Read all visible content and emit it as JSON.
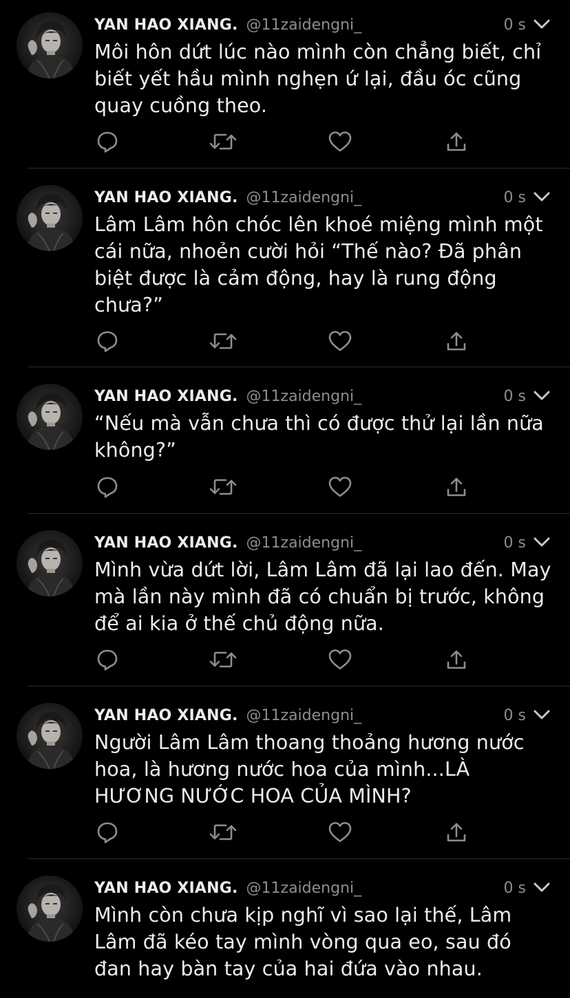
{
  "author": {
    "name": "YAN HAO XIANG.",
    "handle": "@11zaidengni_"
  },
  "colors": {
    "background": "#000000",
    "text": "#ececec",
    "secondary": "#8b8d91",
    "icon": "#8b8d91",
    "divider": "#2b2d30"
  },
  "icons": {
    "reply": "reply-icon",
    "retweet": "retweet-icon",
    "like": "heart-icon",
    "share": "share-icon",
    "more": "chevron-down-icon"
  },
  "tweets": [
    {
      "time": "0 s",
      "lines": [
        "Môi hôn dứt lúc nào mình còn chẳng biết, chỉ",
        "biết yết hầu mình nghẹn ứ lại, đầu óc cũng",
        "quay cuồng theo."
      ]
    },
    {
      "time": "0 s",
      "lines": [
        "Lâm Lâm hôn chóc lên khoé miệng mình một",
        "cái nữa, nhoẻn cười hỏi “Thế nào? Đã phân",
        "biệt được là cảm động, hay là rung động",
        "chưa?”"
      ]
    },
    {
      "time": "0 s",
      "lines": [
        "“Nếu mà vẫn chưa thì có được thử lại lần nữa",
        "không?”"
      ]
    },
    {
      "time": "0 s",
      "lines": [
        "Mình vừa dứt lời, Lâm Lâm đã lại lao đến. May",
        "mà lần này mình đã có chuẩn bị trước, không",
        "để ai kia ở thế chủ động nữa."
      ]
    },
    {
      "time": "0 s",
      "lines": [
        "Người Lâm Lâm thoang thoảng hương nước",
        "hoa, là hương nước hoa của mình...LÀ",
        "HƯƠNG NƯỚC HOA CỦA MÌNH?"
      ]
    },
    {
      "time": "0 s",
      "lines": [
        "Mình còn chưa kịp nghĩ vì sao lại thế, Lâm",
        "Lâm đã kéo tay mình vòng qua eo, sau đó",
        "đan hay bàn tay của hai đứa vào nhau."
      ]
    }
  ]
}
